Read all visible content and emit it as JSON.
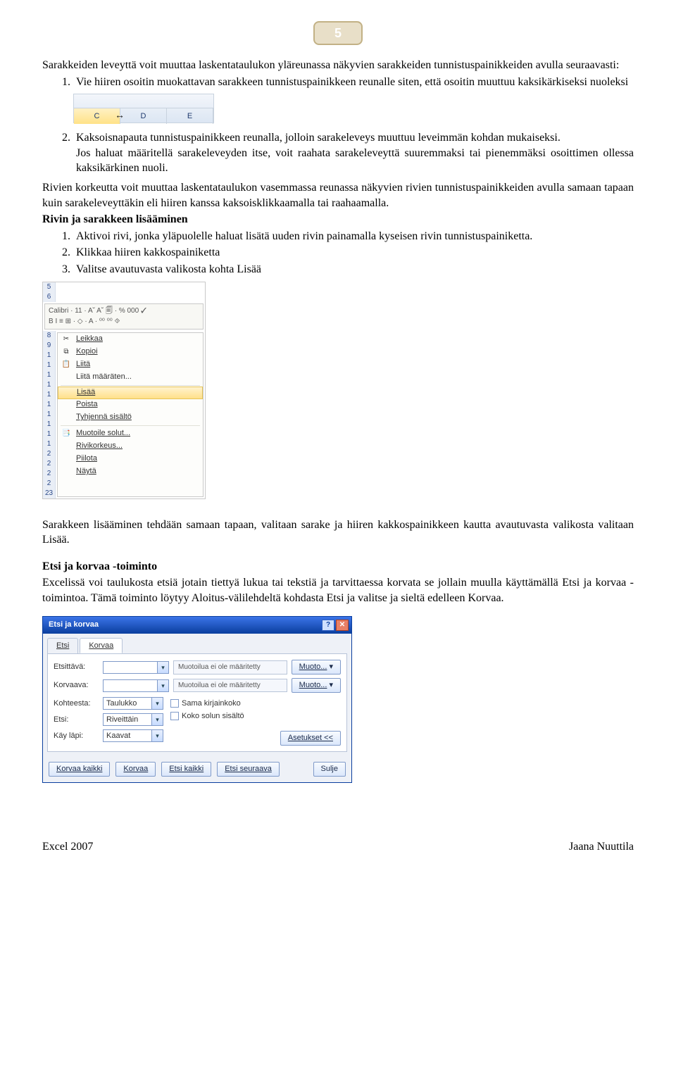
{
  "page_number": "5",
  "intro_para": "Sarakkeiden leveyttä voit muuttaa laskentataulukon yläreunassa näkyvien sarakkeiden tunnistuspainikkeiden avulla seuraavasti:",
  "list1": {
    "item1": "Vie hiiren osoitin muokattavan sarakkeen tunnistuspainikkeen reunalle siten, että osoitin muuttuu kaksikärkiseksi nuoleksi"
  },
  "headers1": {
    "c": "C",
    "d": "D",
    "e": "E",
    "cursor": "↔"
  },
  "list2": {
    "item2a": "Kaksoisnapauta tunnistuspainikkeen reunalla, jolloin sarakeleveys muuttuu leveimmän kohdan mukaiseksi.",
    "item2b": "Jos haluat määritellä sarakeleveyden itse, voit raahata sarakeleveyttä suuremmaksi tai pienemmäksi osoittimen ollessa kaksikärkinen nuoli."
  },
  "para_rivien": "Rivien korkeutta voit muuttaa laskentataulukon vasemmassa reunassa näkyvien rivien tunnistuspainikkeiden avulla samaan tapaan kuin sarakeleveyttäkin eli hiiren kanssa kaksoisklikkaamalla tai raahaamalla.",
  "heading_rivi": "Rivin ja sarakkeen lisääminen",
  "list3": {
    "i1": "Aktivoi rivi, jonka yläpuolelle haluat lisätä uuden rivin painamalla kyseisen rivin tunnistuspainiketta.",
    "i2": "Klikkaa hiiren kakkospainiketta",
    "i3": "Valitse avautuvasta valikosta kohta Lisää"
  },
  "rownums_top": {
    "a": "5",
    "b": "6"
  },
  "mini": {
    "line1": "Calibri · 11 · A˘ A˘ 🗐 · % 000 ✓",
    "line2": "B I ≡ ⊞ · ◇ · A · ⁰⁰ ⁰⁰ ⯑"
  },
  "rownums": [
    "8",
    "9",
    "1",
    "1",
    "1",
    "1",
    "1",
    "1",
    "1",
    "1",
    "1",
    "1",
    "2",
    "2",
    "2",
    "2",
    "23"
  ],
  "menu": {
    "leikkaa": "Leikkaa",
    "kopioi": "Kopioi",
    "liita": "Liitä",
    "liita_m": "Liitä määräten...",
    "lisaa": "Lisää",
    "poista": "Poista",
    "tyhjenna": "Tyhjennä sisältö",
    "muotoile": "Muotoile solut...",
    "rivikork": "Rivikorkeus...",
    "piilota": "Piilota",
    "nayta": "Näytä"
  },
  "para_sarake": "Sarakkeen lisääminen tehdään samaan tapaan, valitaan sarake ja hiiren kakkospainikkeen kautta avautuvasta valikosta valitaan Lisää.",
  "heading_etsi": "Etsi ja korvaa -toiminto",
  "para_etsi": "Excelissä voi taulukosta etsiä jotain tiettyä lukua tai tekstiä ja tarvittaessa korvata se jollain muulla käyttämällä  Etsi ja korvaa -toimintoa. Tämä toiminto löytyy Aloitus-välilehdeltä kohdasta Etsi ja valitse ja sieltä edelleen Korvaa.",
  "dialog": {
    "title": "Etsi ja korvaa",
    "tab_etsi": "Etsi",
    "tab_korvaa": "Korvaa",
    "lbl_etsittava": "Etsittävä:",
    "lbl_korvaava": "Korvaava:",
    "fmt_none": "Muotoilua ei ole määritetty",
    "btn_muoto": "Muoto...",
    "lbl_kohteesta": "Kohteesta:",
    "val_taulukko": "Taulukko",
    "lbl_etsi2": "Etsi:",
    "val_riveittain": "Riveittäin",
    "lbl_kay": "Käy läpi:",
    "val_kaavat": "Kaavat",
    "chk_kirjain": "Sama kirjainkoko",
    "chk_koko": "Koko solun sisältö",
    "btn_asetukset": "Asetukset <<",
    "btn_korvaa_kaikki": "Korvaa kaikki",
    "btn_korvaa": "Korvaa",
    "btn_etsi_kaikki": "Etsi kaikki",
    "btn_etsi_seur": "Etsi seuraava",
    "btn_sulje": "Sulje",
    "help": "?",
    "close_x": "✕"
  },
  "footer": {
    "left": "Excel 2007",
    "right": "Jaana Nuuttila"
  }
}
